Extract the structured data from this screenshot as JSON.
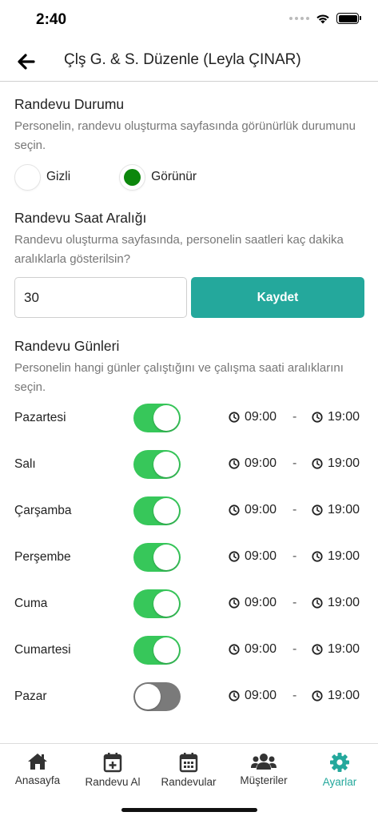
{
  "status_bar": {
    "time": "2:40"
  },
  "header": {
    "title": "Çlş G. & S. Düzenle (Leyla ÇINAR)"
  },
  "visibility": {
    "title": "Randevu Durumu",
    "description": "Personelin, randevu oluşturma sayfasında görünürlük durumunu seçin.",
    "options": [
      {
        "label": "Gizli",
        "selected": false
      },
      {
        "label": "Görünür",
        "selected": true
      }
    ],
    "selected_color": "#0c870c"
  },
  "interval": {
    "title": "Randevu Saat Aralığı",
    "description": "Randevu oluşturma sayfasında, personelin saatleri kaç dakika aralıklarla gösterilsin?",
    "value": "30",
    "save_label": "Kaydet",
    "button_color": "#24a89c"
  },
  "days": {
    "title": "Randevu Günleri",
    "description": "Personelin hangi günler çalıştığını ve çalışma saati aralıklarını seçin.",
    "separator": "-",
    "items": [
      {
        "name": "Pazartesi",
        "enabled": true,
        "start": "09:00",
        "end": "19:00"
      },
      {
        "name": "Salı",
        "enabled": true,
        "start": "09:00",
        "end": "19:00"
      },
      {
        "name": "Çarşamba",
        "enabled": true,
        "start": "09:00",
        "end": "19:00"
      },
      {
        "name": "Perşembe",
        "enabled": true,
        "start": "09:00",
        "end": "19:00"
      },
      {
        "name": "Cuma",
        "enabled": true,
        "start": "09:00",
        "end": "19:00"
      },
      {
        "name": "Cumartesi",
        "enabled": true,
        "start": "09:00",
        "end": "19:00"
      },
      {
        "name": "Pazar",
        "enabled": false,
        "start": "09:00",
        "end": "19:00"
      }
    ],
    "switch_on_color": "#37c75a",
    "switch_off_color": "#7a7a7a"
  },
  "tabs": [
    {
      "label": "Anasayfa",
      "icon": "home-icon",
      "active": false
    },
    {
      "label": "Randevu Al",
      "icon": "calendar-plus-icon",
      "active": false
    },
    {
      "label": "Randevular",
      "icon": "calendar-icon",
      "active": false
    },
    {
      "label": "Müşteriler",
      "icon": "users-icon",
      "active": false
    },
    {
      "label": "Ayarlar",
      "icon": "gear-icon",
      "active": true
    }
  ],
  "accent_color": "#24a89c"
}
